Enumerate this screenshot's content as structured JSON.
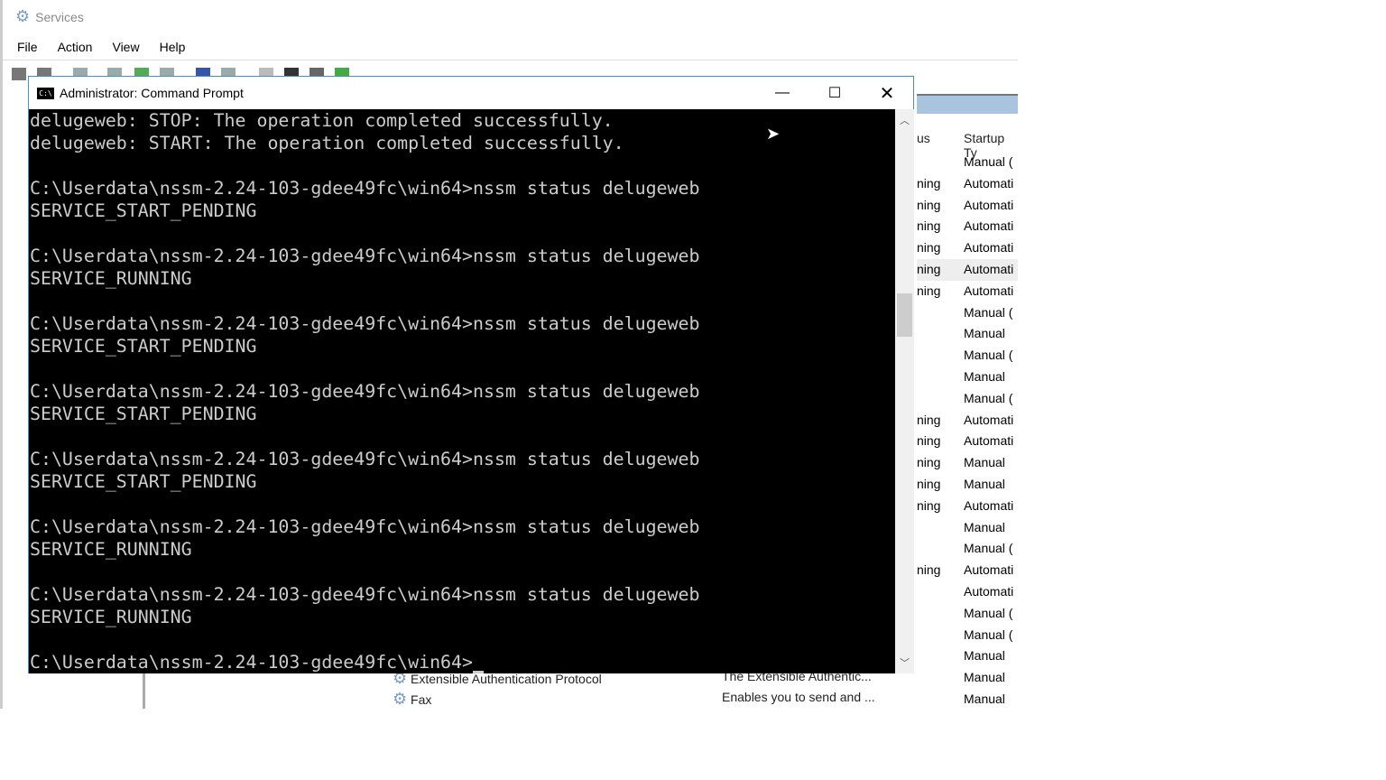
{
  "services": {
    "title": "Services",
    "menu": [
      "File",
      "Action",
      "View",
      "Help"
    ],
    "columns": {
      "status_partial": "us",
      "startup_partial": "Startup Ty"
    },
    "rows": [
      {
        "status": "",
        "startup": "Manual ("
      },
      {
        "status": "ning",
        "startup": "Automati"
      },
      {
        "status": "ning",
        "startup": "Automati"
      },
      {
        "status": "ning",
        "startup": "Automati"
      },
      {
        "status": "ning",
        "startup": "Automati"
      },
      {
        "status": "ning",
        "startup": "Automati"
      },
      {
        "status": "ning",
        "startup": "Automati"
      },
      {
        "status": "",
        "startup": "Manual ("
      },
      {
        "status": "",
        "startup": "Manual"
      },
      {
        "status": "",
        "startup": "Manual ("
      },
      {
        "status": "",
        "startup": "Manual"
      },
      {
        "status": "",
        "startup": "Manual ("
      },
      {
        "status": "ning",
        "startup": "Automati"
      },
      {
        "status": "ning",
        "startup": "Automati"
      },
      {
        "status": "ning",
        "startup": "Manual"
      },
      {
        "status": "ning",
        "startup": "Manual"
      },
      {
        "status": "ning",
        "startup": "Automati"
      },
      {
        "status": "",
        "startup": "Manual"
      },
      {
        "status": "",
        "startup": "Manual ("
      },
      {
        "status": "ning",
        "startup": "Automati"
      },
      {
        "status": "",
        "startup": "Automati"
      },
      {
        "status": "",
        "startup": "Manual ("
      },
      {
        "status": "",
        "startup": "Manual ("
      },
      {
        "status": "",
        "startup": "Manual"
      },
      {
        "status": "",
        "startup": "Manual"
      },
      {
        "status": "",
        "startup": "Manual"
      }
    ],
    "visible_items": [
      {
        "name": "Extensible Authentication Protocol",
        "description": "The Extensible Authentic..."
      },
      {
        "name": "Fax",
        "description": "Enables you to send and ..."
      }
    ]
  },
  "cmd": {
    "title": "Administrator: Command Prompt",
    "lines": [
      "delugeweb: STOP: The operation completed successfully.",
      "delugeweb: START: The operation completed successfully.",
      "",
      "C:\\Userdata\\nssm-2.24-103-gdee49fc\\win64>nssm status delugeweb",
      "SERVICE_START_PENDING",
      "",
      "C:\\Userdata\\nssm-2.24-103-gdee49fc\\win64>nssm status delugeweb",
      "SERVICE_RUNNING",
      "",
      "C:\\Userdata\\nssm-2.24-103-gdee49fc\\win64>nssm status delugeweb",
      "SERVICE_START_PENDING",
      "",
      "C:\\Userdata\\nssm-2.24-103-gdee49fc\\win64>nssm status delugeweb",
      "SERVICE_START_PENDING",
      "",
      "C:\\Userdata\\nssm-2.24-103-gdee49fc\\win64>nssm status delugeweb",
      "SERVICE_START_PENDING",
      "",
      "C:\\Userdata\\nssm-2.24-103-gdee49fc\\win64>nssm status delugeweb",
      "SERVICE_RUNNING",
      "",
      "C:\\Userdata\\nssm-2.24-103-gdee49fc\\win64>nssm status delugeweb",
      "SERVICE_RUNNING",
      ""
    ],
    "prompt": "C:\\Userdata\\nssm-2.24-103-gdee49fc\\win64>"
  }
}
